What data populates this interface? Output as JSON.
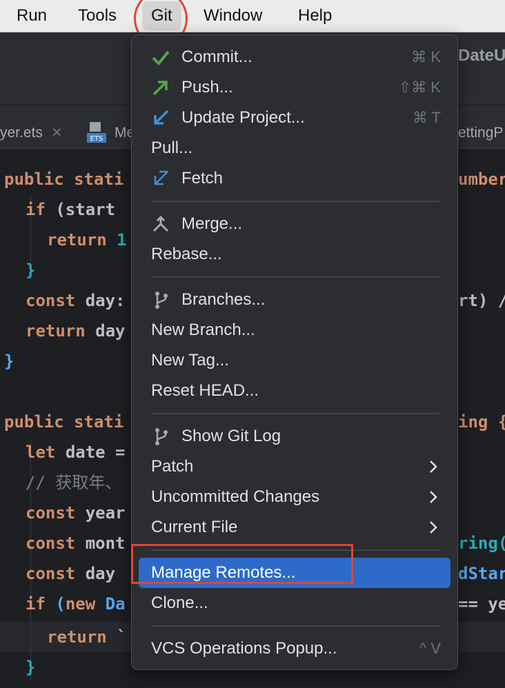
{
  "menubar": {
    "items": [
      "Run",
      "Tools",
      "Git",
      "Window",
      "Help"
    ]
  },
  "toolbar": {
    "right_title": "DateU"
  },
  "tabs": [
    {
      "label": "yer.ets"
    },
    {
      "label": "Me"
    },
    {
      "label": "ettingP"
    }
  ],
  "ets_icon": "ETS",
  "git_menu": {
    "items": [
      {
        "label": "Commit...",
        "icon": "check-icon",
        "shortcut": "⌘ K"
      },
      {
        "label": "Push...",
        "icon": "push-arrow-icon",
        "shortcut": "⇧⌘ K"
      },
      {
        "label": "Update Project...",
        "icon": "update-arrow-icon",
        "shortcut": "⌘ T"
      },
      {
        "label": "Pull...",
        "icon": "",
        "shortcut": ""
      },
      {
        "label": "Fetch",
        "icon": "fetch-arrow-icon",
        "shortcut": ""
      },
      {
        "label": "Merge...",
        "icon": "merge-icon",
        "shortcut": ""
      },
      {
        "label": "Rebase...",
        "icon": "",
        "shortcut": ""
      },
      {
        "label": "Branches...",
        "icon": "branch-icon",
        "shortcut": ""
      },
      {
        "label": "New Branch...",
        "icon": "",
        "shortcut": ""
      },
      {
        "label": "New Tag...",
        "icon": "",
        "shortcut": ""
      },
      {
        "label": "Reset HEAD...",
        "icon": "",
        "shortcut": ""
      },
      {
        "label": "Show Git Log",
        "icon": "git-log-icon",
        "shortcut": ""
      },
      {
        "label": "Patch",
        "icon": "",
        "submenu": true
      },
      {
        "label": "Uncommitted Changes",
        "icon": "",
        "submenu": true
      },
      {
        "label": "Current File",
        "icon": "",
        "submenu": true
      },
      {
        "label": "Manage Remotes...",
        "icon": "",
        "selected": true
      },
      {
        "label": "Clone...",
        "icon": ""
      },
      {
        "label": "VCS Operations Popup...",
        "icon": "",
        "shortcut": "^ V"
      }
    ]
  },
  "code": {
    "l1_kw": "public",
    "l1_rest": "stati",
    "l2_kw": "if",
    "l2_rest": "(start",
    "l3_kw": "return",
    "l3_num": "1",
    "l4_brace": "}",
    "l5_kw": "const",
    "l5_rest": "day:",
    "l6_kw": "return",
    "l6_rest": "day",
    "l7_brace": "}",
    "l8_kw": "public",
    "l8_rest": "stati",
    "l9_kw": "let",
    "l9_rest": "date =",
    "l10_comment": "// 获取年、",
    "l11_kw": "const",
    "l11_rest": "year",
    "l12_kw": "const",
    "l12_rest": "mont",
    "l13_kw": "const",
    "l13_rest": "day",
    "l14_kw": "if",
    "l14_paren": "(",
    "l14_new": "new",
    "l14_rest": "Da",
    "l15_kw": "return",
    "l15_rest": "`",
    "l16_brace": "}",
    "right_1": "umber",
    "right_2": "rt) /",
    "right_3": "ing {",
    "right_4": "ring(",
    "right_5": "dStar",
    "right_6": "== ye"
  },
  "colors": {
    "highlight": "#2e6ac8",
    "annotation_red": "#e0453a",
    "check_green": "#57a64a",
    "arrow_blue": "#3d8fd6"
  }
}
